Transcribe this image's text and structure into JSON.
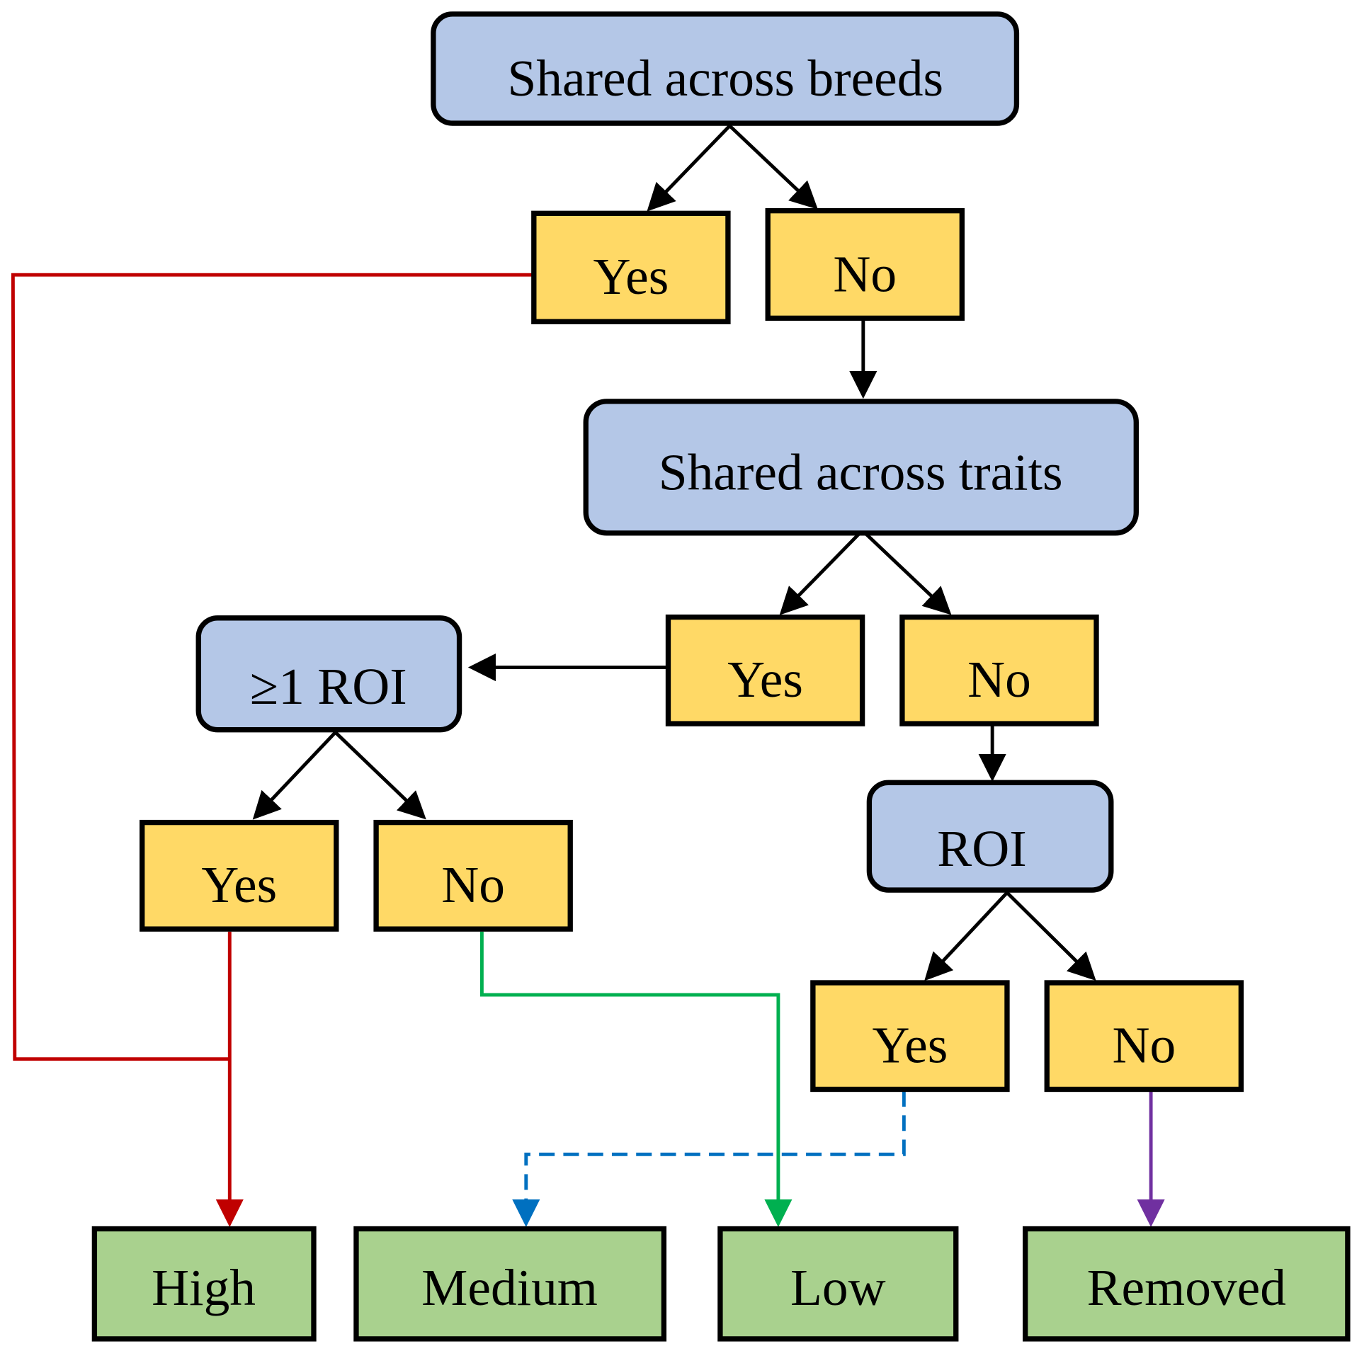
{
  "colors": {
    "question": "#b4c7e7",
    "answer": "#ffd966",
    "outcome": "#a9d18e",
    "high_path": "#c00000",
    "low_path": "#00b050",
    "medium_path": "#0070c0",
    "removed_path": "#7030a0"
  },
  "nodes": {
    "q1": "Shared across breeds",
    "q1_yes": "Yes",
    "q1_no": "No",
    "q2": "Shared across traits",
    "q2_yes": "Yes",
    "q2_no": "No",
    "q3": "≥1 ROI",
    "q3_yes": "Yes",
    "q3_no": "No",
    "q4": "ROI",
    "q4_yes": "Yes",
    "q4_no": "No",
    "high": "High",
    "medium": "Medium",
    "low": "Low",
    "removed": "Removed"
  }
}
